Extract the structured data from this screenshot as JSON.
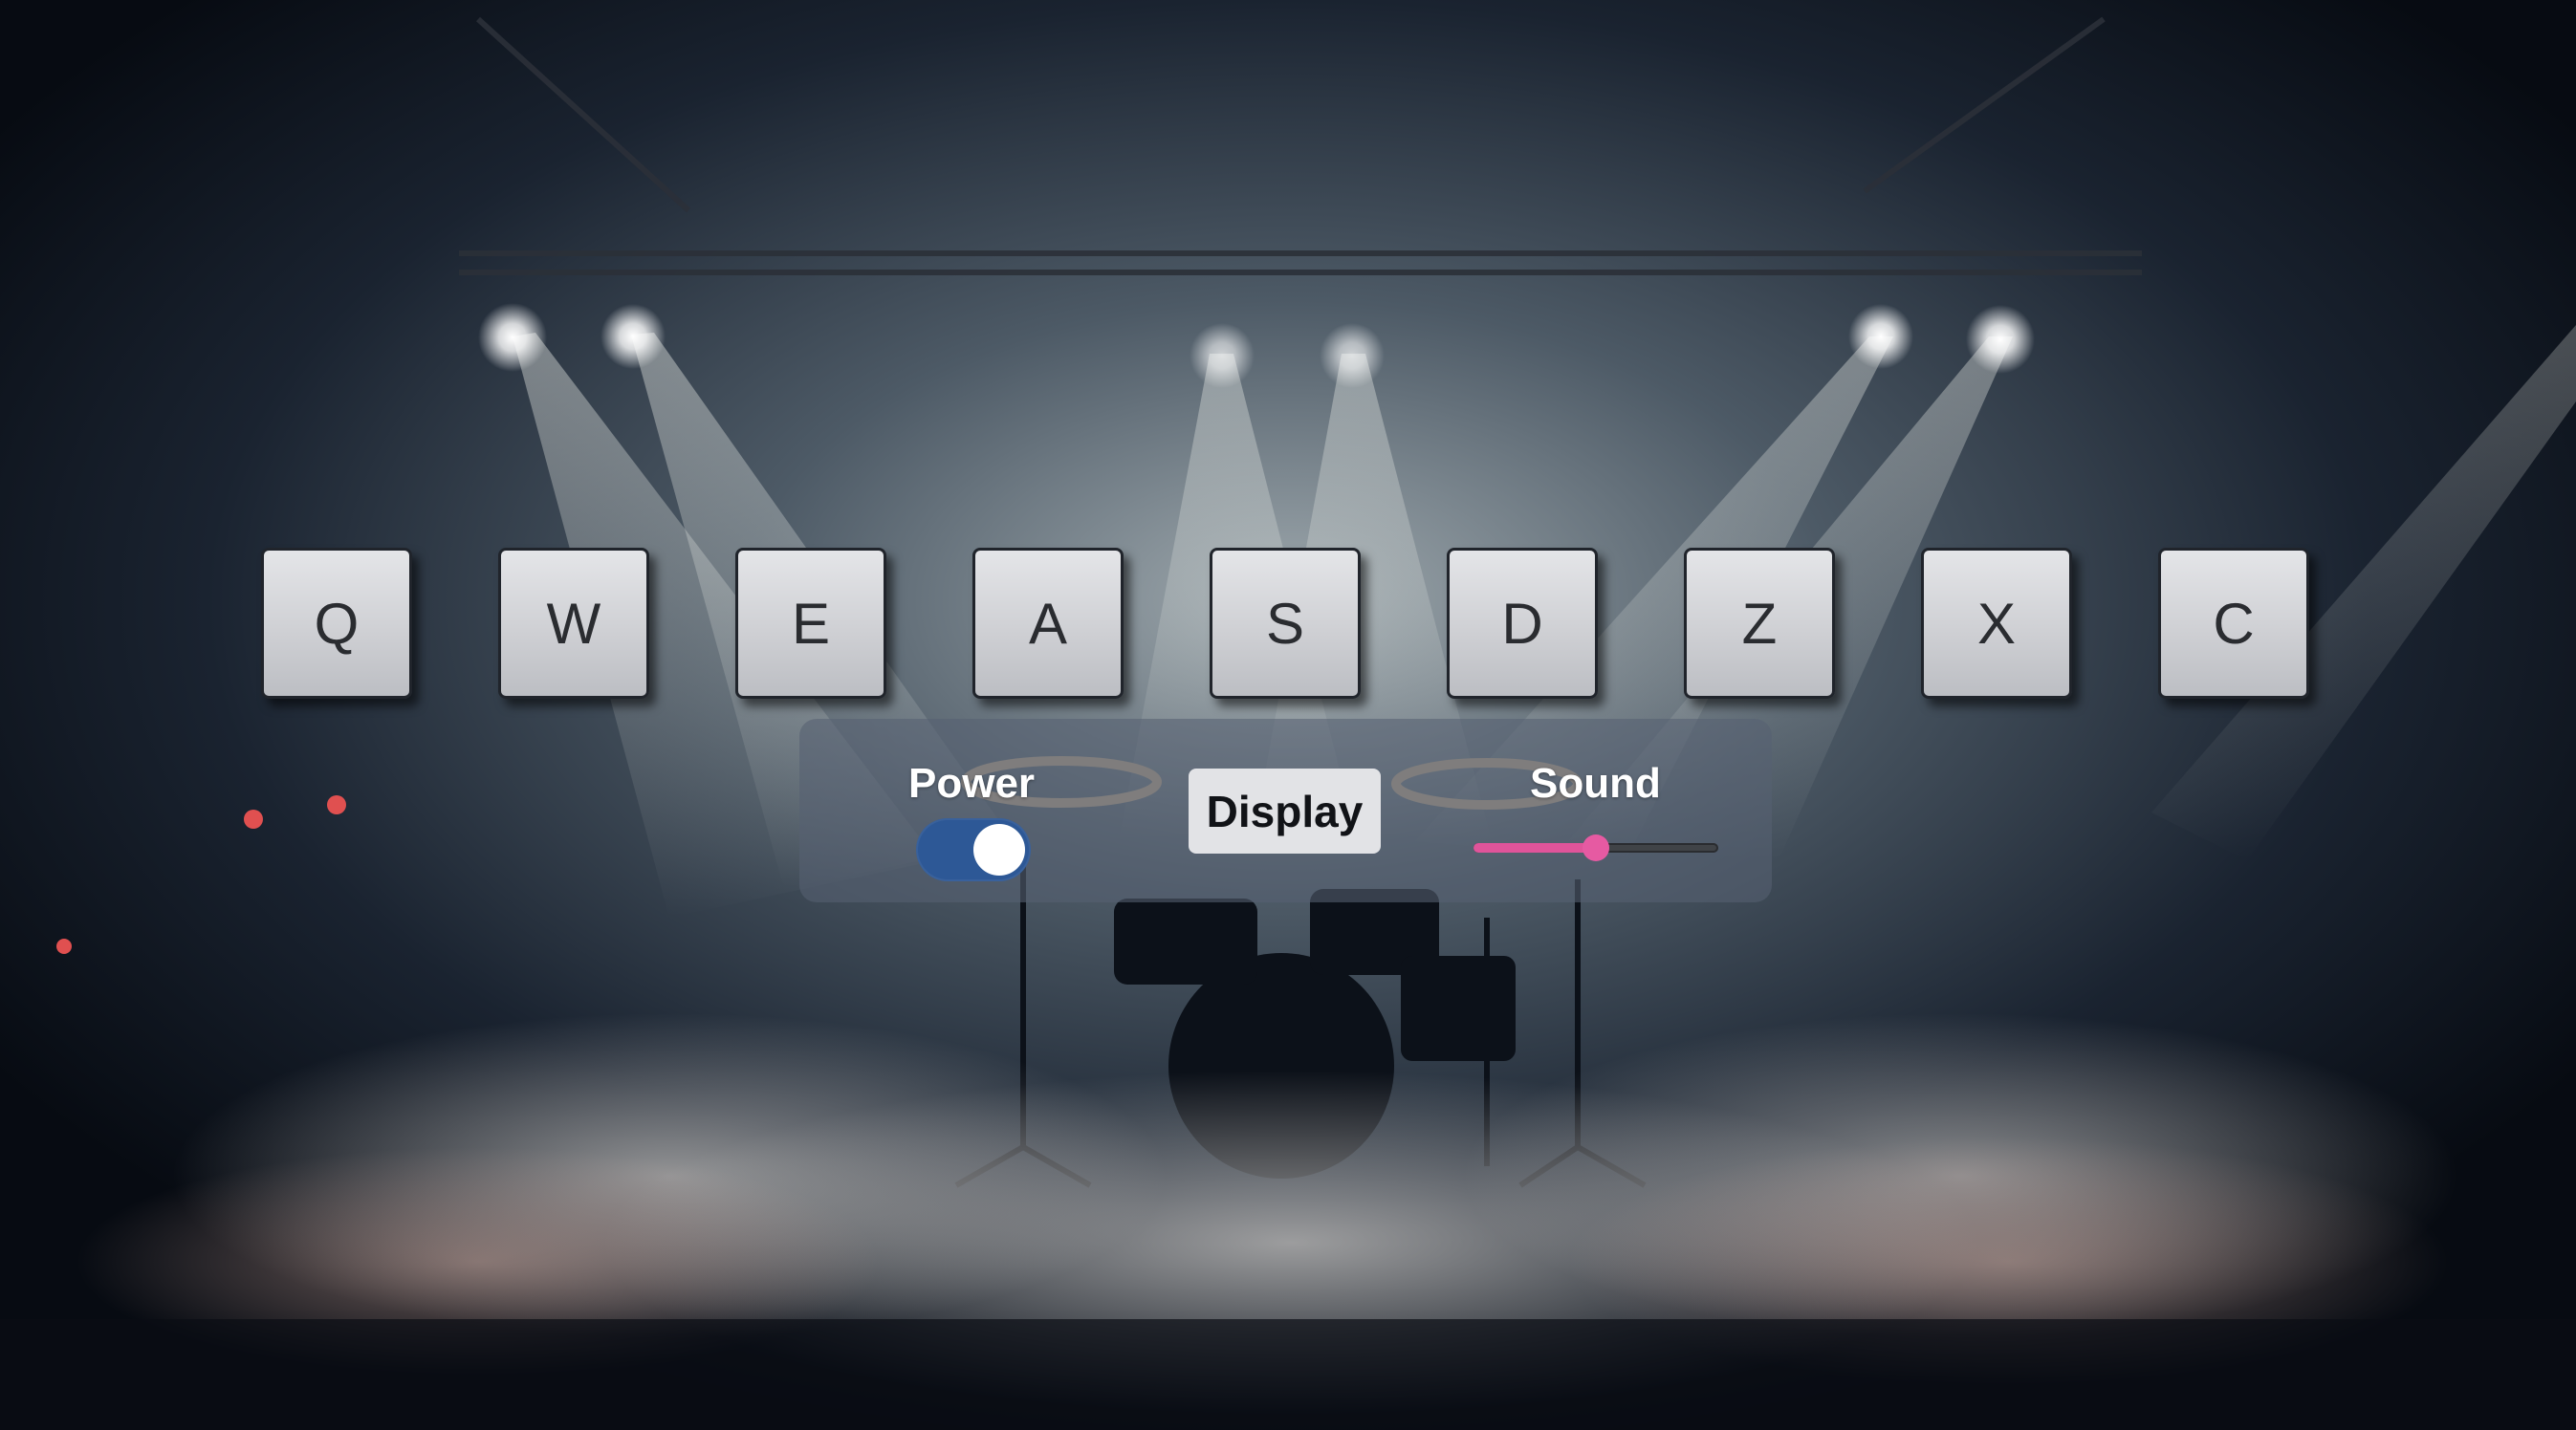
{
  "drum_machine": {
    "pads": [
      {
        "key": "Q"
      },
      {
        "key": "W"
      },
      {
        "key": "E"
      },
      {
        "key": "A"
      },
      {
        "key": "S"
      },
      {
        "key": "D"
      },
      {
        "key": "Z"
      },
      {
        "key": "X"
      },
      {
        "key": "C"
      }
    ],
    "controls": {
      "power_label": "Power",
      "power_on": true,
      "display_text": "Display",
      "sound_label": "Sound",
      "volume": 0.5
    }
  },
  "colors": {
    "toggle_on": "#2d5896",
    "slider_accent": "#e0549a",
    "pad_face": "#d4d5d8",
    "panel": "#566072"
  }
}
